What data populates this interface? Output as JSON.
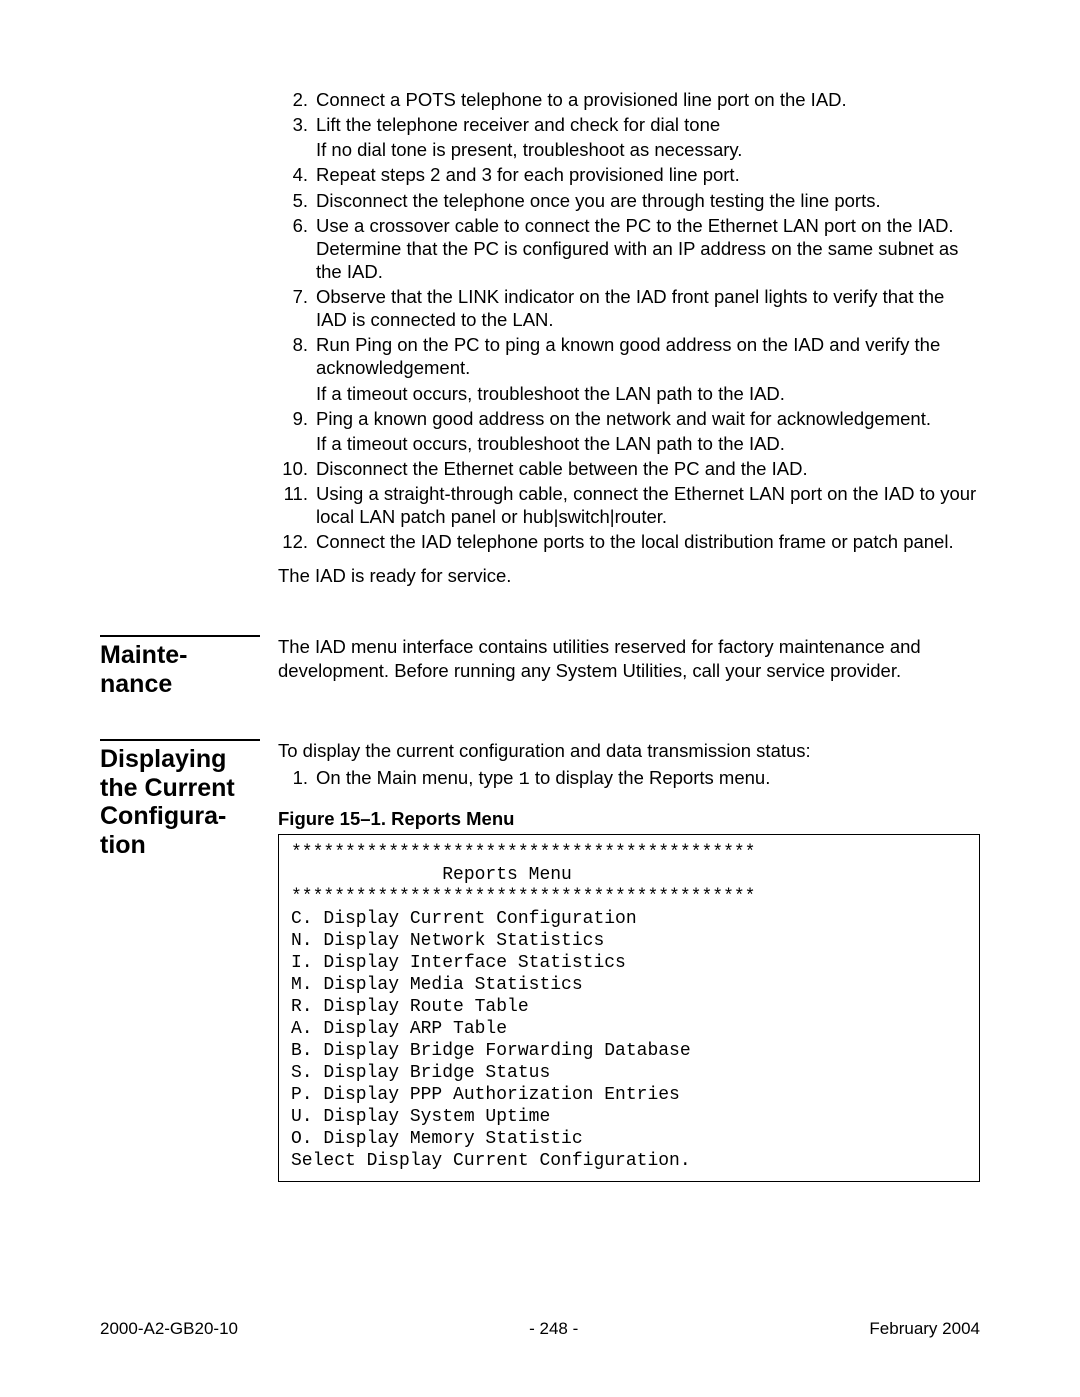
{
  "steps": [
    {
      "n": "2.",
      "text": "Connect a POTS telephone to a provisioned line port on the IAD."
    },
    {
      "n": "3.",
      "text": "Lift the telephone receiver and check for dial tone",
      "sub": [
        "If no dial tone is present, troubleshoot as necessary."
      ]
    },
    {
      "n": "4.",
      "text": "Repeat steps 2 and 3 for each provisioned line port."
    },
    {
      "n": "5.",
      "text": "Disconnect the telephone once you are through testing the line ports."
    },
    {
      "n": "6.",
      "text": "Use a crossover cable to connect the PC to the Ethernet LAN port on the IAD. Determine that the PC is configured with an IP address on the same subnet as the IAD."
    },
    {
      "n": "7.",
      "text": "Observe that the LINK indicator on the IAD front panel lights to verify that the IAD is connected to the LAN."
    },
    {
      "n": "8.",
      "text": "Run Ping on the PC to ping a known good address on the IAD and verify the acknowledgement.",
      "sub": [
        "If a timeout occurs, troubleshoot the LAN path to the IAD."
      ]
    },
    {
      "n": "9.",
      "text": "Ping a known good address on the network and wait for acknowledgement.",
      "sub": [
        "If a timeout occurs, troubleshoot the LAN path to the IAD."
      ]
    },
    {
      "n": "10.",
      "text": "Disconnect the Ethernet cable between the PC and the IAD."
    },
    {
      "n": "11.",
      "text": "Using a straight-through cable, connect the Ethernet LAN port on the IAD to your local LAN patch panel or hub|switch|router."
    },
    {
      "n": "12.",
      "text": "Connect the IAD telephone ports to the local distribution frame or patch panel."
    }
  ],
  "closing": "The IAD is ready for service.",
  "sections": {
    "maintenance": {
      "title": "Mainte-\nnance",
      "body": "The IAD menu interface contains utilities reserved for factory maintenance and development. Before running any System Utilities, call your service provider."
    },
    "displaying": {
      "title": "Displaying the Current Configura-\ntion",
      "intro": "To display the current configuration and data transmission status:",
      "step1_num": "1.",
      "step1_pre": "On the Main menu, type ",
      "step1_mono": "1",
      "step1_post": " to display the Reports menu.",
      "fig_caption": "Figure 15–1.  Reports Menu",
      "figure_text": "*******************************************\n              Reports Menu\n*******************************************\nC. Display Current Configuration\nN. Display Network Statistics\nI. Display Interface Statistics\nM. Display Media Statistics\nR. Display Route Table\nA. Display ARP Table\nB. Display Bridge Forwarding Database\nS. Display Bridge Status\nP. Display PPP Authorization Entries\nU. Display System Uptime\nO. Display Memory Statistic\nSelect Display Current Configuration."
    }
  },
  "footer": {
    "left": "2000-A2-GB20-10",
    "center": "- 248 -",
    "right": "February 2004"
  }
}
